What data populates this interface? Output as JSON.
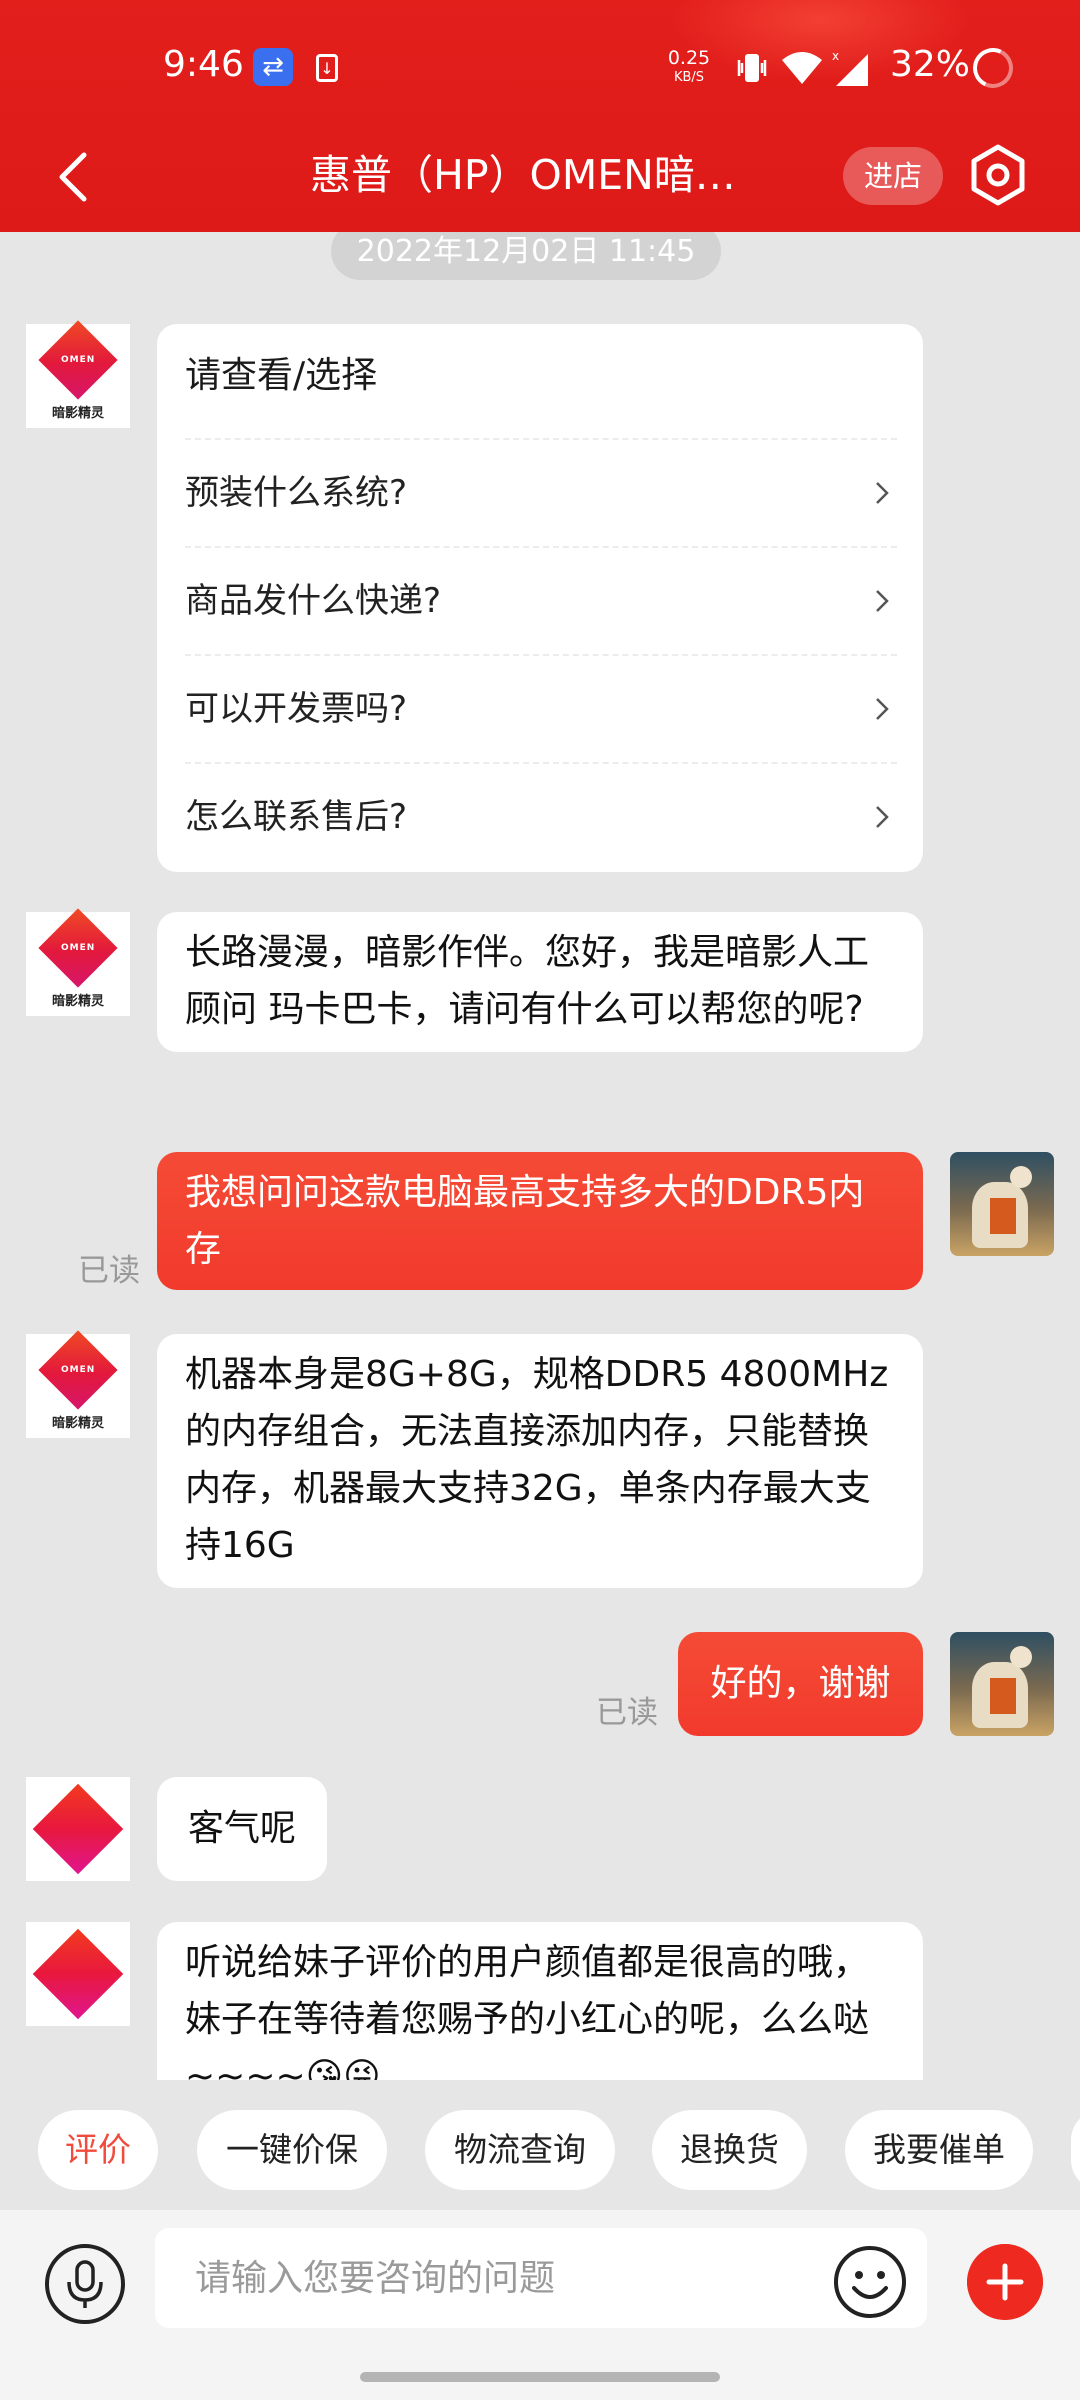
{
  "status_bar": {
    "time": "9:46",
    "net_speed": "0.25",
    "net_unit": "KB/S",
    "battery": "32%"
  },
  "nav": {
    "title": "惠普（HP）OMEN暗…",
    "store_button": "进店"
  },
  "chat": {
    "timestamp": "2022年12月02日 11:45",
    "shop_avatar_text": "OMEN",
    "shop_avatar_caption": "暗影精灵",
    "menu_card": {
      "heading": "请查看/选择",
      "items": [
        "预装什么系统?",
        "商品发什么快递?",
        "可以开发票吗?",
        "怎么联系售后?"
      ]
    },
    "messages": [
      {
        "from": "shop",
        "text": "长路漫漫，暗影作伴。您好，我是暗影人工顾问 玛卡巴卡，请问有什么可以帮您的呢?"
      },
      {
        "from": "user",
        "text": "我想问问这款电脑最高支持多大的DDR5内存",
        "status": "已读"
      },
      {
        "from": "shop",
        "text": "机器本身是8G+8G，规格DDR5 4800MHz的内存组合，无法直接添加内存，只能替换内存，机器最大支持32G，单条内存最大支持16G"
      },
      {
        "from": "user",
        "text": "好的，谢谢",
        "status": "已读"
      },
      {
        "from": "shop",
        "text": "客气呢"
      },
      {
        "from": "shop",
        "text": "听说给妹子评价的用户颜值都是很高的哦，妹子在等待着您赐予的小红心的呢，么么哒~~~~😘😜"
      }
    ]
  },
  "quick_actions": [
    "评价",
    "一键价保",
    "物流查询",
    "退换货",
    "我要催单"
  ],
  "input": {
    "placeholder": "请输入您要咨询的问题"
  },
  "colors": {
    "header_red": "#e31f1c",
    "user_bubble": "#f23a2c",
    "accent_text": "#f04b3c"
  }
}
